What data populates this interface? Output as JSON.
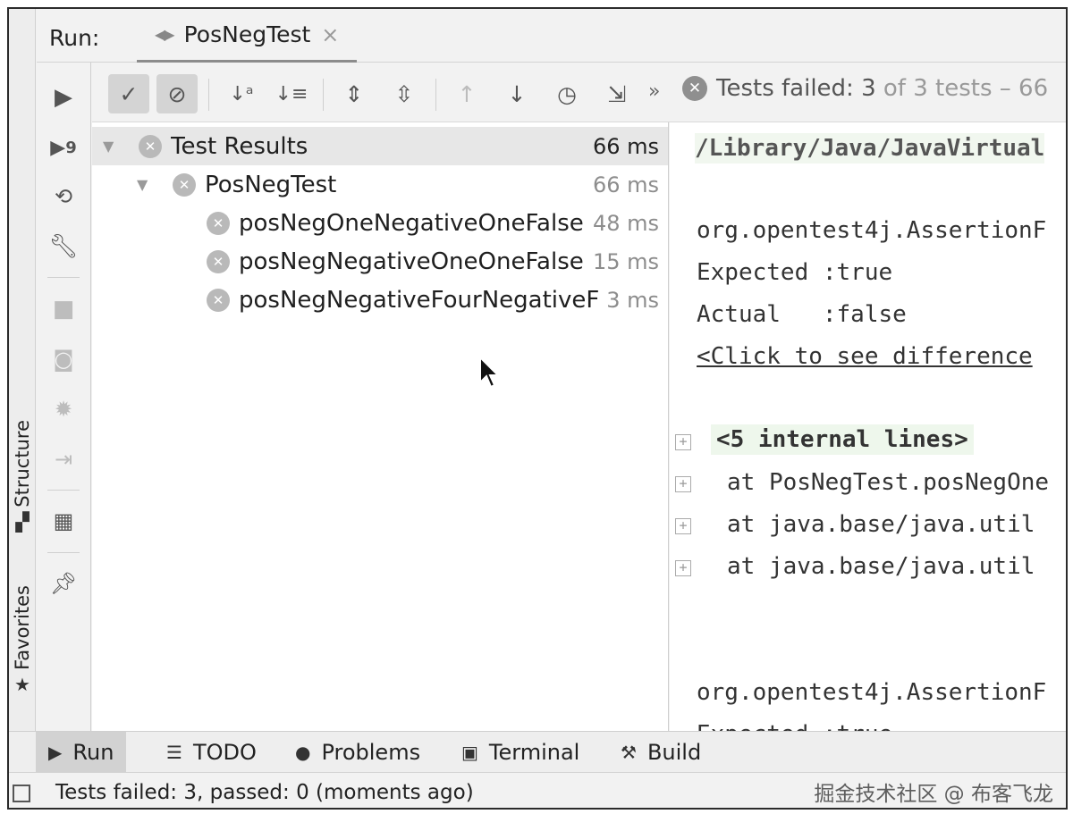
{
  "run_header": {
    "label": "Run:",
    "tab_title": "PosNegTest",
    "tab_icon": "◀▶",
    "tab_close": "×"
  },
  "side_tabs": {
    "structure": "Structure",
    "favorites": "Favorites"
  },
  "toolbar": {
    "status_text": "Tests failed:",
    "status_count": "3",
    "status_of": "of 3 tests – 66",
    "overflow": "»"
  },
  "tree": {
    "root": {
      "label": "Test Results",
      "time": "66 ms"
    },
    "suite": {
      "label": "PosNegTest",
      "time": "66 ms"
    },
    "tests": [
      {
        "label": "posNegOneNegativeOneFalse",
        "time": "48 ms"
      },
      {
        "label": "posNegNegativeOneOneFalse",
        "time": "15 ms"
      },
      {
        "label": "posNegNegativeFourNegativeF",
        "time": "3 ms"
      }
    ]
  },
  "console": {
    "path": "/Library/Java/JavaVirtual",
    "exception1": "org.opentest4j.AssertionF",
    "expected1": "Expected :true",
    "actual1": "Actual   :false",
    "diff_link": "<Click to see difference",
    "internal_lines": "<5 internal lines>",
    "trace1": "at PosNegTest.posNegOne",
    "trace2": "at java.base/java.util",
    "trace3": "at java.base/java.util",
    "exception2": "org.opentest4j.AssertionF",
    "expected2": "Expected :true"
  },
  "bottom_tabs": {
    "run": "Run",
    "todo": "TODO",
    "problems": "Problems",
    "terminal": "Terminal",
    "build": "Build"
  },
  "status_bar": {
    "text": "Tests failed: 3, passed: 0 (moments ago)",
    "watermark": "掘金技术社区 @ 布客飞龙"
  },
  "colors": {
    "panel_bg": "#f2f2f2",
    "selection_bg": "#e7e7e7",
    "failed_icon": "#b9b9b9",
    "internal_lines_bg": "#eef7ec"
  }
}
